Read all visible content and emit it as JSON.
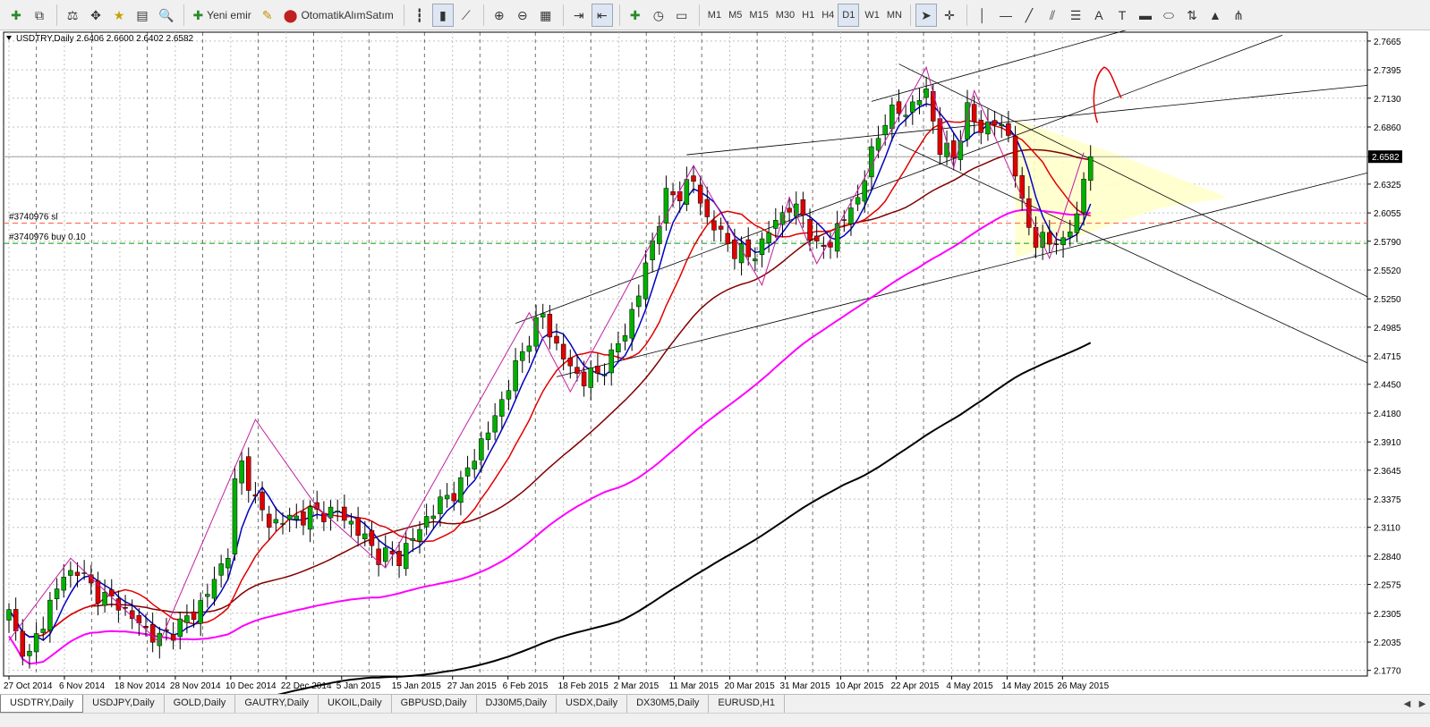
{
  "toolbar": {
    "new_order": "Yeni emir",
    "auto_trading": "OtomatikAlımSatım",
    "timeframes": [
      "M1",
      "M5",
      "M15",
      "M30",
      "H1",
      "H4",
      "D1",
      "W1",
      "MN"
    ],
    "active_timeframe": "D1"
  },
  "chart_data": {
    "type": "candlestick",
    "title": "USDTRY,Daily  2.6406 2.6600 2.6402 2.6582",
    "last_price": "2.6582",
    "yticks": [
      "2.7665",
      "2.7395",
      "2.7130",
      "2.6860",
      "2.6582",
      "2.6325",
      "2.6055",
      "2.5790",
      "2.5520",
      "2.5250",
      "2.4985",
      "2.4715",
      "2.4450",
      "2.4180",
      "2.3910",
      "2.3645",
      "2.3375",
      "2.3110",
      "2.2840",
      "2.2575",
      "2.2305",
      "2.2035",
      "2.1770"
    ],
    "xticks": [
      "27 Oct 2014",
      "6 Nov 2014",
      "18 Nov 2014",
      "28 Nov 2014",
      "10 Dec 2014",
      "22 Dec 2014",
      "5 Jan 2015",
      "15 Jan 2015",
      "27 Jan 2015",
      "6 Feb 2015",
      "18 Feb 2015",
      "2 Mar 2015",
      "11 Mar 2015",
      "20 Mar 2015",
      "31 Mar 2015",
      "10 Apr 2015",
      "22 Apr 2015",
      "4 May 2015",
      "14 May 2015",
      "26 May 2015"
    ],
    "ylim": [
      2.1717,
      2.7748
    ],
    "levels": {
      "sl_label": "#3740976 sl",
      "sl_price": 2.596,
      "buy_label": "#3740976 buy 0.10",
      "buy_price": 2.577,
      "last": 2.6582
    },
    "ohlc_control_points": [
      [
        0,
        2.23
      ],
      [
        1,
        2.21
      ],
      [
        3,
        2.19
      ],
      [
        6,
        2.24
      ],
      [
        8,
        2.265
      ],
      [
        10,
        2.272
      ],
      [
        12,
        2.255
      ],
      [
        14,
        2.245
      ],
      [
        16,
        2.24
      ],
      [
        18,
        2.226
      ],
      [
        20,
        2.215
      ],
      [
        22,
        2.206
      ],
      [
        24,
        2.215
      ],
      [
        27,
        2.23
      ],
      [
        30,
        2.26
      ],
      [
        32,
        2.29
      ],
      [
        33,
        2.35
      ],
      [
        34,
        2.37
      ],
      [
        35,
        2.355
      ],
      [
        36,
        2.335
      ],
      [
        38,
        2.315
      ],
      [
        42,
        2.32
      ],
      [
        45,
        2.325
      ],
      [
        48,
        2.325
      ],
      [
        50,
        2.315
      ],
      [
        52,
        2.3
      ],
      [
        54,
        2.285
      ],
      [
        57,
        2.283
      ],
      [
        59,
        2.3
      ],
      [
        61,
        2.32
      ],
      [
        64,
        2.34
      ],
      [
        66,
        2.35
      ],
      [
        68,
        2.38
      ],
      [
        70,
        2.4
      ],
      [
        72,
        2.43
      ],
      [
        74,
        2.46
      ],
      [
        76,
        2.49
      ],
      [
        78,
        2.51
      ],
      [
        80,
        2.48
      ],
      [
        82,
        2.46
      ],
      [
        84,
        2.45
      ],
      [
        86,
        2.455
      ],
      [
        88,
        2.47
      ],
      [
        90,
        2.495
      ],
      [
        92,
        2.53
      ],
      [
        94,
        2.58
      ],
      [
        96,
        2.62
      ],
      [
        98,
        2.625
      ],
      [
        100,
        2.635
      ],
      [
        102,
        2.6
      ],
      [
        104,
        2.585
      ],
      [
        106,
        2.57
      ],
      [
        108,
        2.565
      ],
      [
        110,
        2.575
      ],
      [
        112,
        2.6
      ],
      [
        114,
        2.61
      ],
      [
        116,
        2.605
      ],
      [
        118,
        2.57
      ],
      [
        120,
        2.58
      ],
      [
        122,
        2.6
      ],
      [
        124,
        2.62
      ],
      [
        126,
        2.66
      ],
      [
        128,
        2.695
      ],
      [
        130,
        2.7
      ],
      [
        132,
        2.705
      ],
      [
        134,
        2.72
      ],
      [
        136,
        2.665
      ],
      [
        138,
        2.66
      ],
      [
        140,
        2.7
      ],
      [
        142,
        2.685
      ],
      [
        144,
        2.69
      ],
      [
        146,
        2.68
      ],
      [
        148,
        2.61
      ],
      [
        150,
        2.58
      ],
      [
        152,
        2.578
      ],
      [
        154,
        2.58
      ],
      [
        156,
        2.6
      ],
      [
        157,
        2.64
      ],
      [
        158,
        2.6582
      ]
    ]
  },
  "tabs": [
    "USDTRY,Daily",
    "USDJPY,Daily",
    "GOLD,Daily",
    "GAUTRY,Daily",
    "UKOIL,Daily",
    "GBPUSD,Daily",
    "DJ30M5,Daily",
    "USDX,Daily",
    "DX30M5,Daily",
    "EURUSD,H1"
  ],
  "active_tab": "USDTRY,Daily",
  "colors": {
    "chart_bg": "#ffffff",
    "grid": "#c0c0c0",
    "bull": "#00b000",
    "bear": "#e00000",
    "ma_fast": "#0000c0",
    "ma_mid": "#e00000",
    "ma_slow": "#800000",
    "ma_100": "#ff00ff",
    "ma_200": "#000000",
    "zigzag": "#c020a0",
    "triangle_fill": "#ffffc8",
    "sl_line": "#ff6040",
    "buy_line": "#00a000"
  }
}
